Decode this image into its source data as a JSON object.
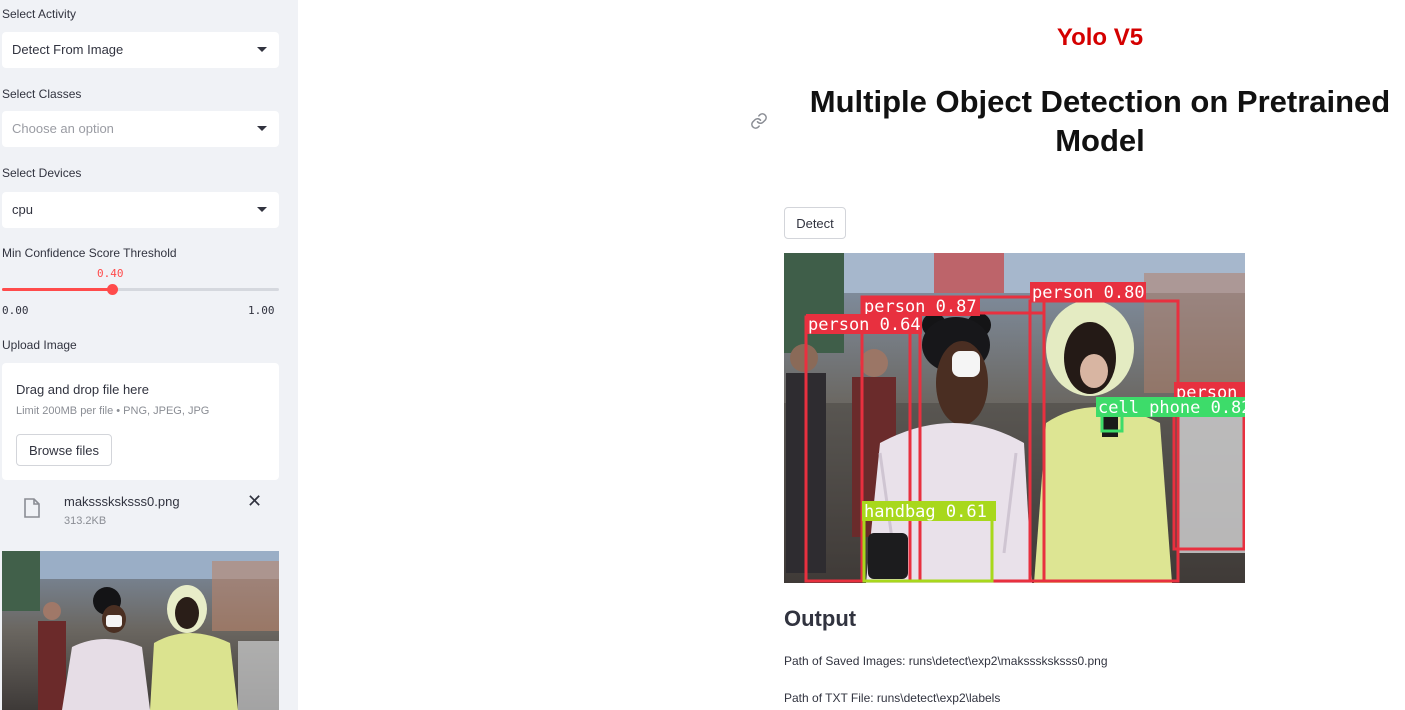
{
  "sidebar": {
    "activity": {
      "label": "Select Activity",
      "value": "Detect From Image"
    },
    "classes": {
      "label": "Select Classes",
      "placeholder": "Choose an option"
    },
    "devices": {
      "label": "Select Devices",
      "value": "cpu"
    },
    "confidence": {
      "label": "Min Confidence Score Threshold",
      "value": "0.40",
      "min": "0.00",
      "max": "1.00",
      "fraction": 0.4
    },
    "upload": {
      "label": "Upload Image",
      "drop_text": "Drag and drop file here",
      "limit_text": "Limit 200MB per file • PNG, JPEG, JPG",
      "browse_label": "Browse files",
      "file_name": "maksssksksss0.png",
      "file_size": "313.2KB",
      "remove_icon": "✕"
    }
  },
  "main": {
    "app_title": "Yolo V5",
    "page_title": "Multiple Object Detection on Pretrained Model",
    "detect_label": "Detect",
    "detections": [
      {
        "label": "person 0.87"
      },
      {
        "label": "person 0.80"
      },
      {
        "label": "person 0.64"
      },
      {
        "label": "person"
      },
      {
        "label": "cell phone 0.82"
      },
      {
        "label": "handbag 0.61"
      }
    ],
    "output_heading": "Output",
    "saved_images_path": "Path of Saved Images: runs\\detect\\exp2\\maksssksksss0.png",
    "txt_file_path": "Path of TXT File: runs\\detect\\exp2\\labels"
  },
  "colors": {
    "accent": "#ff4b4b",
    "title_red": "#d40000",
    "sidebar_bg": "#f0f2f6",
    "person_box": "#e8303f",
    "phone_box": "#3ddc6a",
    "handbag_box": "#a8d81c"
  },
  "icons": {
    "file": "file-icon",
    "link": "link-icon",
    "caret": "caret-down-icon",
    "close": "close-icon"
  }
}
